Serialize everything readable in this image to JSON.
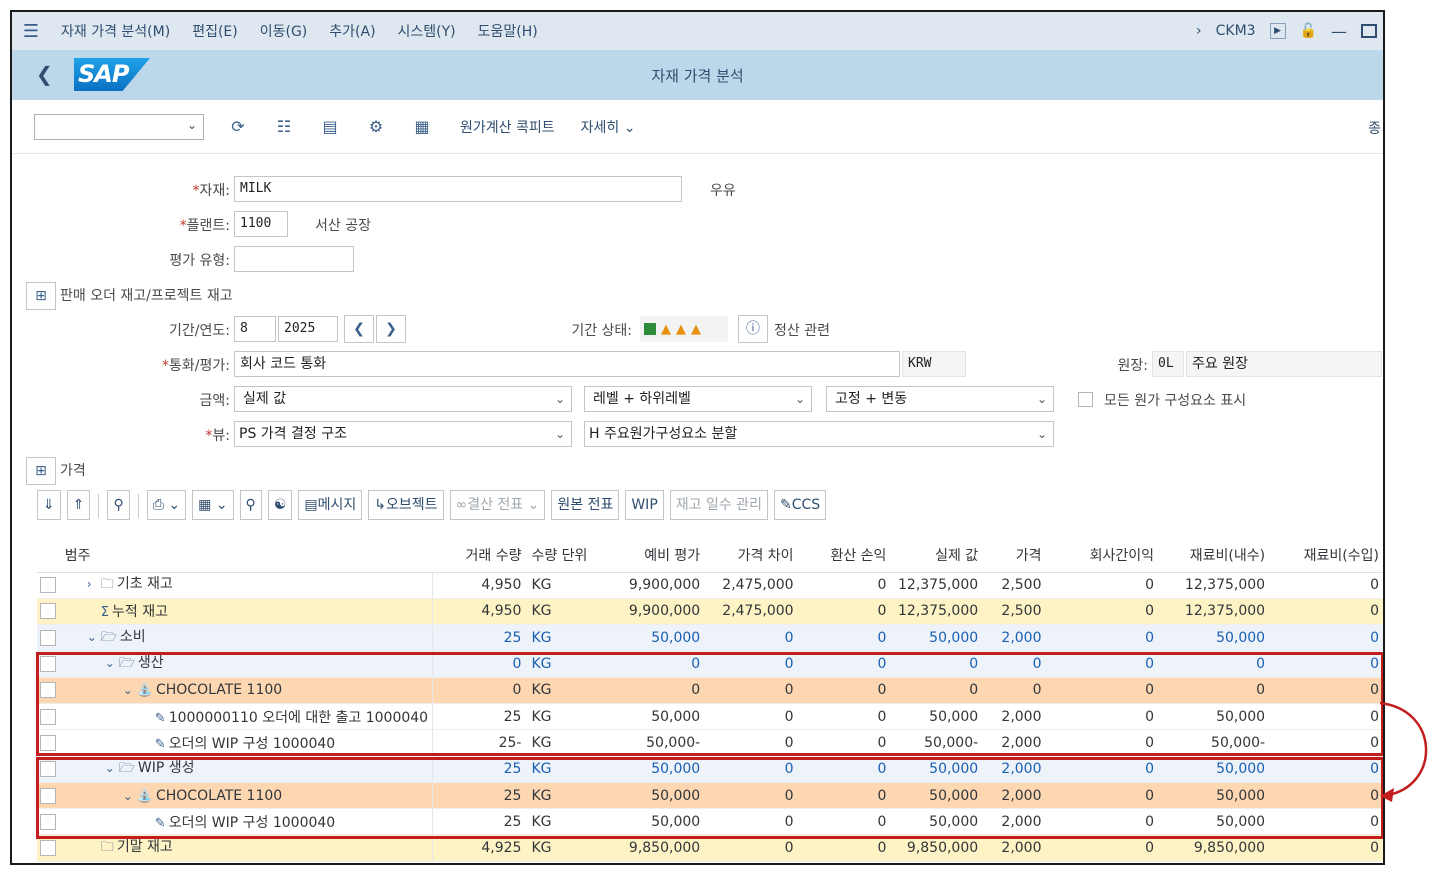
{
  "menu": {
    "items": [
      "자재 가격 분석(M)",
      "편집(E)",
      "이동(G)",
      "추가(A)",
      "시스템(Y)",
      "도움말(H)"
    ],
    "tcode": "CKM3"
  },
  "title": "자재 가격 분석",
  "toolbar": {
    "cockpit": "원가계산 콕피트",
    "more": "자세히",
    "right_cut": "종"
  },
  "form": {
    "material_label": "자재:",
    "material_value": "MILK",
    "material_desc": "우유",
    "plant_label": "플랜트:",
    "plant_value": "1100",
    "plant_desc": "서산 공장",
    "valtype_label": "평가 유형:",
    "sales_order_toggle": "판매 오더 재고/프로젝트 재고",
    "period_label": "기간/연도:",
    "period_value": "8",
    "year_value": "2025",
    "period_status_label": "기간 상태:",
    "closing_label": "정산 관련",
    "currency_label": "통화/평가:",
    "currency_value": "회사 코드 통화",
    "currency_code": "KRW",
    "ledger_label": "원장:",
    "ledger_value": "0L",
    "ledger_desc": "주요 원장",
    "amount_label": "금액:",
    "amount_value": "실제 값",
    "level_value": "레벨 + 하위레벨",
    "fixvar_value": "고정 + 변동",
    "show_all_label": "모든 원가 구성요소 표시",
    "view_label": "뷰:",
    "view_value": "PS 가격 결정 구조",
    "component_value": "H 주요원가구성요소 분할",
    "price_toggle": "가격"
  },
  "grid_buttons": {
    "message": "메시지",
    "object": "오브젝트",
    "closing_doc": "결산 전표",
    "orig_doc": "원본 전표",
    "wip": "WIP",
    "stock_days": "재고 일수 관리",
    "ccs": "CCS"
  },
  "table": {
    "headers": [
      "범주",
      "거래 수량",
      "수량 단위",
      "예비 평가",
      "가격 차이",
      "환산 손익",
      "실제 값",
      "가격",
      "회사간이익",
      "재료비(내수)",
      "재료비(수입)"
    ],
    "rows": [
      {
        "indent": 0,
        "chev": ">",
        "icon": "folder",
        "label": "기초 재고",
        "qty": "4,950",
        "unit": "KG",
        "prelim": "9,900,000",
        "pricediff": "2,475,000",
        "fx": "0",
        "actual": "12,375,000",
        "price": "2,500",
        "interco": "0",
        "mat_dom": "12,375,000",
        "mat_imp": "0",
        "style": "white"
      },
      {
        "indent": 0,
        "chev": "",
        "icon": "sum",
        "label": "누적 재고",
        "qty": "4,950",
        "unit": "KG",
        "prelim": "9,900,000",
        "pricediff": "2,475,000",
        "fx": "0",
        "actual": "12,375,000",
        "price": "2,500",
        "interco": "0",
        "mat_dom": "12,375,000",
        "mat_imp": "0",
        "style": "yellow"
      },
      {
        "indent": 0,
        "chev": "v",
        "icon": "folder-open",
        "label": "소비",
        "qty": "25",
        "unit": "KG",
        "prelim": "50,000",
        "pricediff": "0",
        "fx": "0",
        "actual": "50,000",
        "price": "2,000",
        "interco": "0",
        "mat_dom": "50,000",
        "mat_imp": "0",
        "style": "blue"
      },
      {
        "indent": 1,
        "chev": "v",
        "icon": "folder-open",
        "label": "생산",
        "qty": "0",
        "unit": "KG",
        "prelim": "0",
        "pricediff": "0",
        "fx": "0",
        "actual": "0",
        "price": "0",
        "interco": "0",
        "mat_dom": "0",
        "mat_imp": "0",
        "style": "blue"
      },
      {
        "indent": 2,
        "chev": "v",
        "icon": "factory",
        "label": "CHOCOLATE 1100",
        "qty": "0",
        "unit": "KG",
        "prelim": "0",
        "pricediff": "0",
        "fx": "0",
        "actual": "0",
        "price": "0",
        "interco": "0",
        "mat_dom": "0",
        "mat_imp": "0",
        "style": "orange"
      },
      {
        "indent": 3,
        "chev": "",
        "icon": "doc",
        "label": "1000000110 오더에 대한 출고 1000040",
        "qty": "25",
        "unit": "KG",
        "prelim": "50,000",
        "pricediff": "0",
        "fx": "0",
        "actual": "50,000",
        "price": "2,000",
        "interco": "0",
        "mat_dom": "50,000",
        "mat_imp": "0",
        "style": "white"
      },
      {
        "indent": 3,
        "chev": "",
        "icon": "doc",
        "label": "오더의 WIP 구성 1000040",
        "qty": "25-",
        "unit": "KG",
        "prelim": "50,000-",
        "pricediff": "0",
        "fx": "0",
        "actual": "50,000-",
        "price": "2,000",
        "interco": "0",
        "mat_dom": "50,000-",
        "mat_imp": "0",
        "style": "white"
      },
      {
        "indent": 1,
        "chev": "v",
        "icon": "folder-open",
        "label": "WIP 생성",
        "qty": "25",
        "unit": "KG",
        "prelim": "50,000",
        "pricediff": "0",
        "fx": "0",
        "actual": "50,000",
        "price": "2,000",
        "interco": "0",
        "mat_dom": "50,000",
        "mat_imp": "0",
        "style": "blue"
      },
      {
        "indent": 2,
        "chev": "v",
        "icon": "factory",
        "label": "CHOCOLATE 1100",
        "qty": "25",
        "unit": "KG",
        "prelim": "50,000",
        "pricediff": "0",
        "fx": "0",
        "actual": "50,000",
        "price": "2,000",
        "interco": "0",
        "mat_dom": "50,000",
        "mat_imp": "0",
        "style": "orange"
      },
      {
        "indent": 3,
        "chev": "",
        "icon": "doc",
        "label": "오더의 WIP 구성 1000040",
        "qty": "25",
        "unit": "KG",
        "prelim": "50,000",
        "pricediff": "0",
        "fx": "0",
        "actual": "50,000",
        "price": "2,000",
        "interco": "0",
        "mat_dom": "50,000",
        "mat_imp": "0",
        "style": "white"
      },
      {
        "indent": 0,
        "chev": "",
        "icon": "folder",
        "label": "기말 재고",
        "qty": "4,925",
        "unit": "KG",
        "prelim": "9,850,000",
        "pricediff": "0",
        "fx": "0",
        "actual": "9,850,000",
        "price": "2,000",
        "interco": "0",
        "mat_dom": "9,850,000",
        "mat_imp": "0",
        "style": "yellow"
      }
    ]
  },
  "colors": {
    "highlight": "#c21e1e",
    "header_blue": "#bcd6ea",
    "menu_blue": "#dfe8f1",
    "row_yellow": "#fdf3c4",
    "row_orange": "#fdd7b1"
  }
}
